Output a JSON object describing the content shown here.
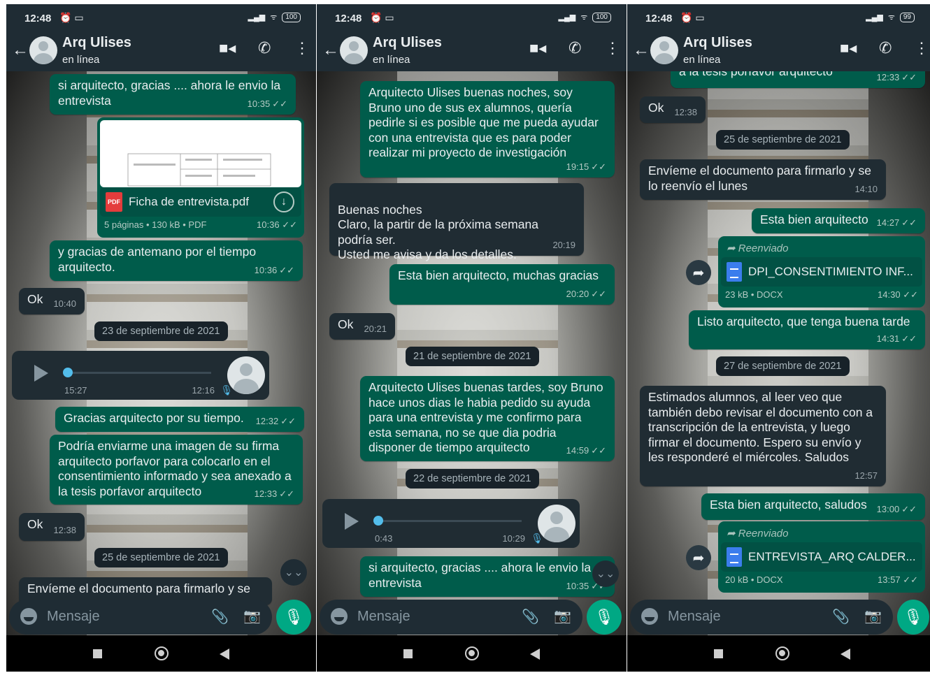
{
  "contact": {
    "name": "Arq Ulises",
    "status": "en línea"
  },
  "composer": {
    "placeholder": "Mensaje"
  },
  "phones": [
    {
      "statusbar": {
        "time": "12:48",
        "battery": "100"
      },
      "messages": [
        {
          "text": "si arquitecto, gracias .... ahora le envio la entrevista",
          "time": "10:35"
        },
        {
          "file": "Ficha de entrevista.pdf",
          "meta": "5 páginas • 130 kB • PDF",
          "time": "10:36"
        },
        {
          "text": "y gracias de antemano por el tiempo arquitecto.",
          "time": "10:36"
        },
        {
          "text": "Ok",
          "time": "10:40"
        },
        {
          "date": "23 de septiembre de 2021"
        },
        {
          "voice_duration": "15:27",
          "time": "12:16"
        },
        {
          "text": "Gracias arquitecto por su tiempo.",
          "time": "12:32"
        },
        {
          "text": "Podría enviarme una imagen de su firma arquitecto porfavor para colocarlo en el consentimiento informado y sea anexado a la tesis porfavor arquitecto",
          "time": "12:33"
        },
        {
          "text": "Ok",
          "time": "12:38"
        },
        {
          "date": "25 de septiembre de 2021"
        },
        {
          "text": "Envíeme el documento para firmarlo y se"
        }
      ]
    },
    {
      "statusbar": {
        "time": "12:48",
        "battery": "100"
      },
      "messages": [
        {
          "text": "Arquitecto Ulises buenas noches, soy Bruno uno de sus ex alumnos, quería pedirle si es posible que me pueda ayudar con una entrevista que es para poder realizar mi proyecto de investigación",
          "time": "19:15"
        },
        {
          "text": "Buenas noches\nClaro, la partir de la próxima semana podría ser.\nUsted me avisa y da los detalles.",
          "time": "20:19"
        },
        {
          "text": "Esta bien arquitecto, muchas gracias",
          "time": "20:20"
        },
        {
          "text": "Ok",
          "time": "20:21"
        },
        {
          "date": "21 de septiembre de 2021"
        },
        {
          "text": "Arquitecto Ulises buenas tardes, soy Bruno hace unos dias le habia pedido su ayuda para una entrevista y me confirmo para esta semana, no se que dia podria disponer de tiempo arquitecto",
          "time": "14:59"
        },
        {
          "date": "22 de septiembre de 2021"
        },
        {
          "voice_duration": "0:43",
          "time": "10:29"
        },
        {
          "text": "si arquitecto, gracias .... ahora le envio la entrevista",
          "time": "10:35"
        }
      ]
    },
    {
      "statusbar": {
        "time": "12:48",
        "battery": "99"
      },
      "messages": [
        {
          "text": "a la tesis porfavor arquitecto",
          "time": "12:33"
        },
        {
          "text": "Ok",
          "time": "12:38"
        },
        {
          "date": "25 de septiembre de 2021"
        },
        {
          "text": "Envíeme el documento para firmarlo y se lo reenvío el lunes",
          "time": "14:10"
        },
        {
          "text": "Esta bien arquitecto",
          "time": "14:27"
        },
        {
          "forwarded": "Reenviado",
          "file": "DPI_CONSENTIMIENTO INF...",
          "meta": "23 kB • DOCX",
          "time": "14:30"
        },
        {
          "text": "Listo arquitecto, que tenga buena tarde",
          "time": "14:31"
        },
        {
          "date": "27 de septiembre de 2021"
        },
        {
          "text": "Estimados alumnos, al leer veo que también debo revisar el documento con a transcripción  de la entrevista, y luego firmar el documento. Espero su envío y les responderé el miércoles. Saludos",
          "time": "12:57"
        },
        {
          "text": "Esta bien arquitecto, saludos",
          "time": "13:00"
        },
        {
          "forwarded": "Reenviado",
          "file": "ENTREVISTA_ARQ CALDER...",
          "meta": "20 kB • DOCX",
          "time": "13:57"
        }
      ]
    }
  ],
  "icons": {
    "back": "arrow-left-icon",
    "video": "video-call-icon",
    "call": "phone-icon",
    "menu": "kebab-menu-icon",
    "mic": "microphone-icon",
    "clip": "paperclip-icon",
    "camera": "camera-icon",
    "emoji": "emoji-icon"
  },
  "colors": {
    "outgoing": "#005c4b",
    "incoming": "#202c33",
    "header": "#1f2c34",
    "accent": "#00a884",
    "date_chip": "#182229"
  }
}
